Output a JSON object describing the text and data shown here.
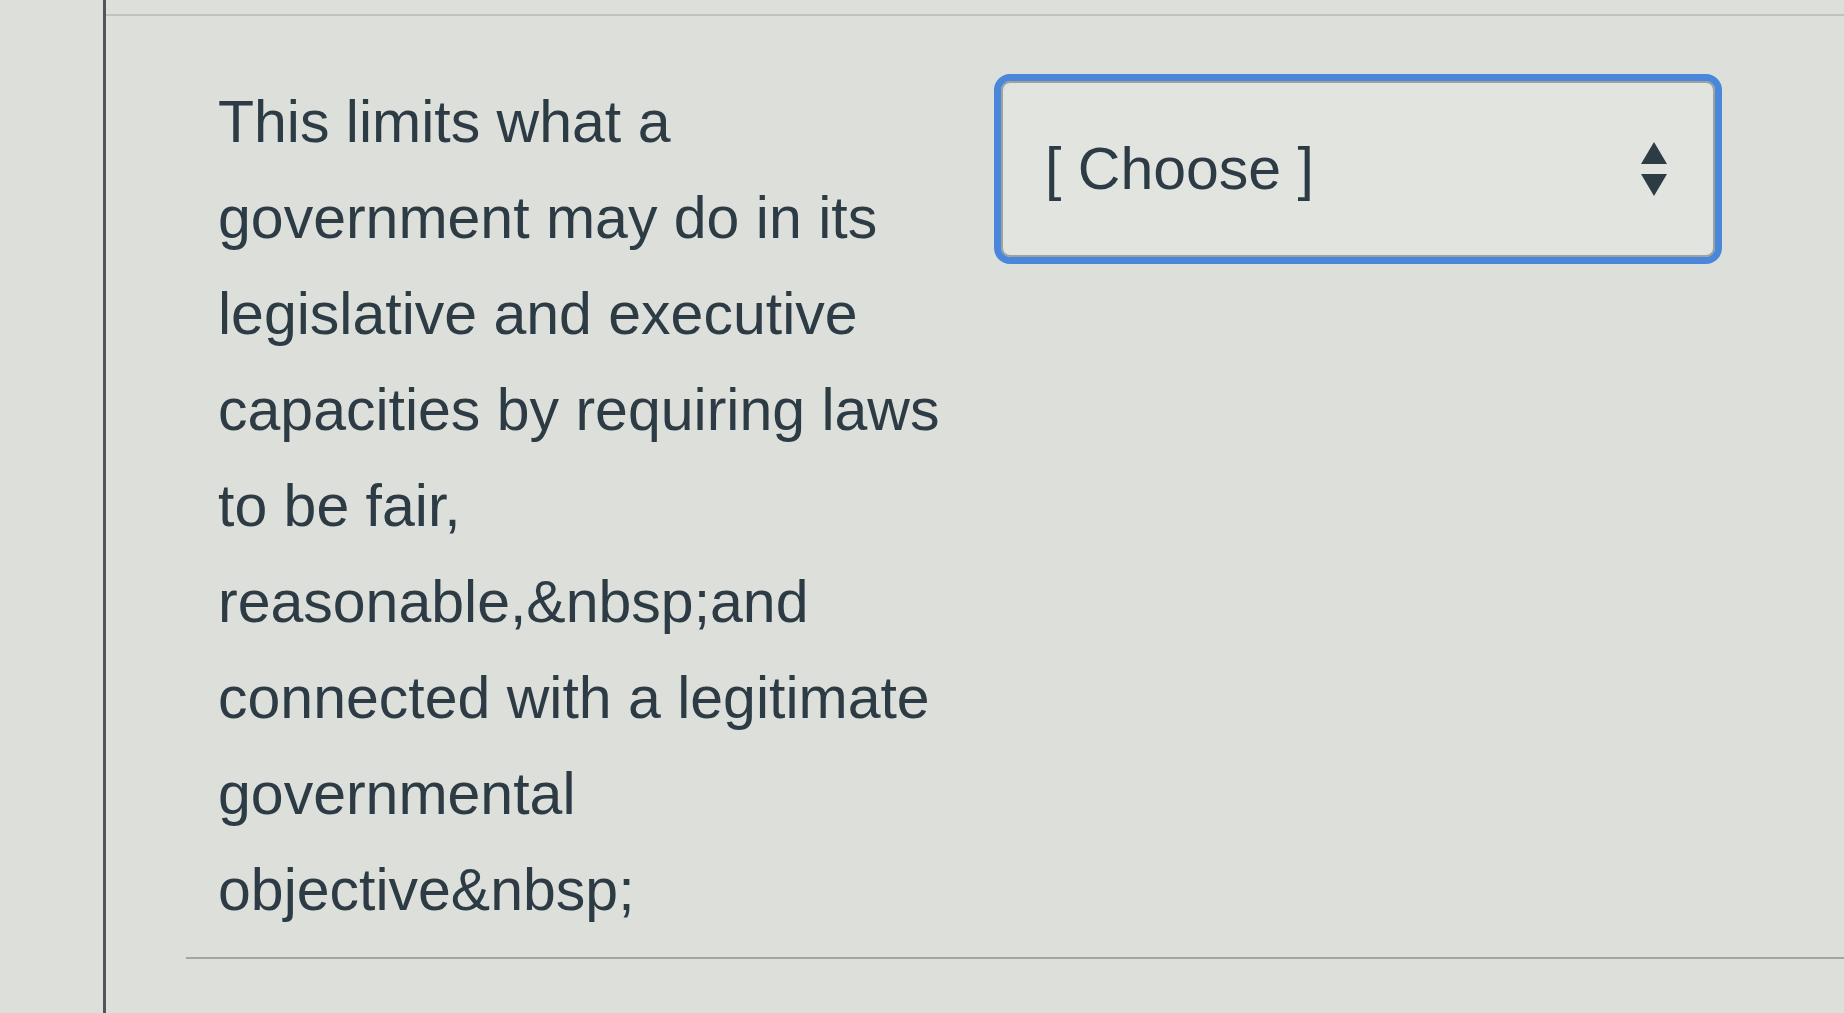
{
  "question": {
    "text": "This limits what a government may do in its legislative and executive capacities by requiring laws to be fair, reasonable,&nbsp;and connected with a legitimate governmental objective&nbsp;"
  },
  "answer_select": {
    "value": "[ Choose ]",
    "focused": true
  }
}
